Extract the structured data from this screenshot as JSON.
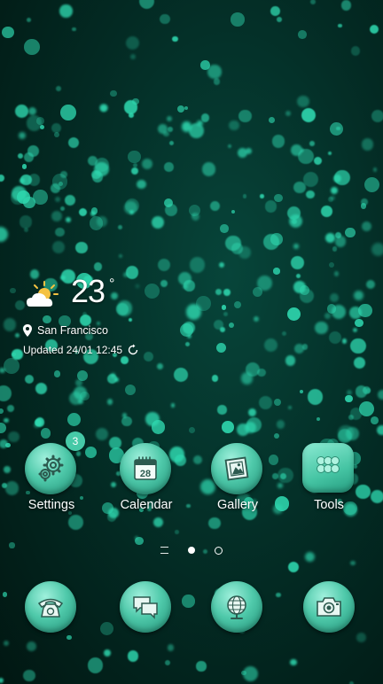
{
  "weather": {
    "temperature": "23",
    "degree": "°",
    "location": "San Francisco",
    "updated": "Updated 24/01 12:45",
    "icon": "partly-sunny-icon"
  },
  "apps": [
    {
      "label": "Settings",
      "icon": "gear-icon",
      "badge": "3"
    },
    {
      "label": "Calendar",
      "icon": "calendar-icon",
      "date": "28"
    },
    {
      "label": "Gallery",
      "icon": "picture-frame-icon"
    },
    {
      "label": "Tools",
      "icon": "app-folder-icon"
    }
  ],
  "dock": [
    {
      "icon": "phone-icon"
    },
    {
      "icon": "messages-icon"
    },
    {
      "icon": "globe-icon"
    },
    {
      "icon": "camera-icon"
    }
  ],
  "page_indicator": {
    "pages": 2,
    "current_page": 1
  },
  "colors": {
    "background": "#03211c",
    "icon_teal": "#4fc9aa",
    "bokeh": "#2fd9b0",
    "text": "#ffffff"
  }
}
